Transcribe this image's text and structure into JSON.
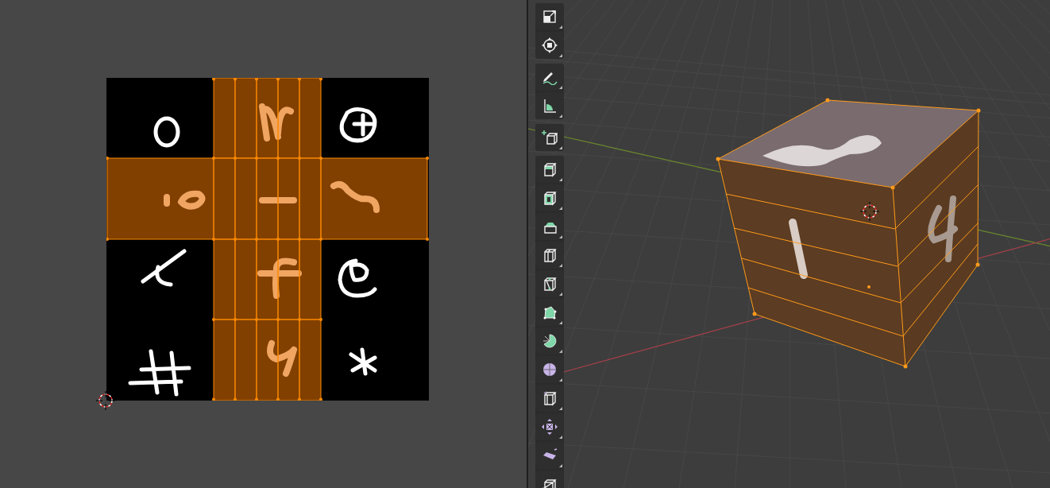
{
  "uv_editor": {
    "faces_selected": true
  },
  "viewport": {
    "mesh_selected": true,
    "tool_groups": [
      [
        {
          "kind": "scale"
        },
        {
          "kind": "transform"
        }
      ],
      [
        {
          "kind": "annotate"
        },
        {
          "kind": "measure"
        }
      ],
      [
        {
          "kind": "add_cube"
        }
      ],
      [
        {
          "kind": "extrude"
        },
        {
          "kind": "inset"
        },
        {
          "kind": "bevel"
        },
        {
          "kind": "loop_cut"
        },
        {
          "kind": "knife"
        },
        {
          "kind": "poly_build"
        },
        {
          "kind": "spin"
        },
        {
          "kind": "smooth"
        },
        {
          "kind": "edge_slide"
        },
        {
          "kind": "shrink"
        },
        {
          "kind": "shear"
        },
        {
          "kind": "rip"
        }
      ]
    ]
  }
}
